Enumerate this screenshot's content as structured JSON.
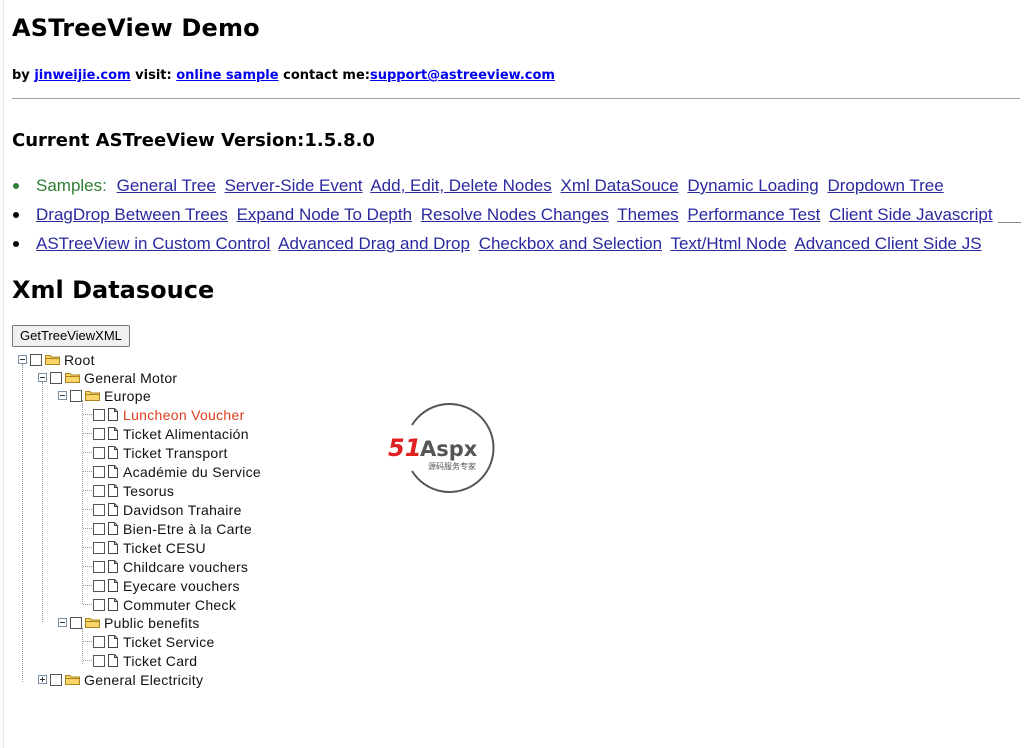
{
  "header": {
    "title": "ASTreeView Demo",
    "by_label": "by",
    "author_link": "jinweijie.com",
    "visit_label": "visit:",
    "sample_link": "online sample",
    "contact_label": "contact me:",
    "email_link": "support@astreeview.com"
  },
  "version": "Current ASTreeView Version:1.5.8.0",
  "nav": {
    "samples_label": "Samples:",
    "rows": [
      [
        "General Tree",
        "Server-Side Event",
        "Add, Edit, Delete Nodes",
        "Xml DataSouce",
        "Dynamic Loading",
        "Dropdown Tree"
      ],
      [
        "DragDrop Between Trees",
        "Expand Node To Depth",
        "Resolve Nodes Changes",
        "Themes",
        "Performance Test",
        "Client Side Javascript"
      ],
      [
        "ASTreeView in Custom Control",
        "Advanced Drag and Drop",
        "Checkbox and Selection",
        "Text/Html Node",
        "Advanced Client Side JS"
      ]
    ]
  },
  "section_title": "Xml Datasouce",
  "button_label": "GetTreeViewXML",
  "tree": {
    "root": "Root",
    "general_motor": "General Motor",
    "europe": "Europe",
    "europe_items": [
      "Luncheon Voucher",
      "Ticket Alimentación",
      "Ticket Transport",
      "Académie du Service",
      "Tesorus",
      "Davidson Trahaire",
      "Bien-Etre à la Carte",
      "Ticket CESU",
      "Childcare vouchers",
      "Eyecare vouchers",
      "Commuter Check"
    ],
    "public_benefits": "Public benefits",
    "public_items": [
      "Ticket Service",
      "Ticket Card"
    ],
    "general_electricity": "General Electricity"
  },
  "logo": {
    "main": "51Aspx",
    "sub": "源码服务专家"
  },
  "colors": {
    "link": "#2a2a9e",
    "samples": "#2e7d32",
    "selected_node": "#e03c1c"
  }
}
